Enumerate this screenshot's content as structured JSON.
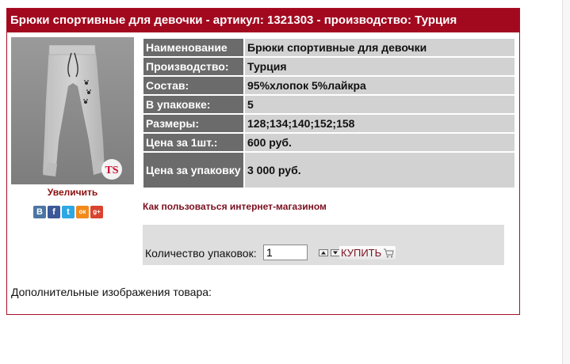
{
  "header": {
    "title": "Брюки спортивные для девочки - артикул: 1321303 - производство: Турция"
  },
  "photo": {
    "brand_mark": "TS"
  },
  "zoom": {
    "label": "Увеличить"
  },
  "share": {
    "items": [
      {
        "icon": "vk-icon",
        "glyph": "В",
        "color": "#4c75a3"
      },
      {
        "icon": "facebook-icon",
        "glyph": "f",
        "color": "#3b5998"
      },
      {
        "icon": "twitter-icon",
        "glyph": "t",
        "color": "#2ea8e5"
      },
      {
        "icon": "odnoklassniki-icon",
        "glyph": "ок",
        "color": "#f28a1b"
      },
      {
        "icon": "google-plus-icon",
        "glyph": "g+",
        "color": "#d9432f"
      }
    ]
  },
  "properties": [
    {
      "key": "Наименование",
      "value": "Брюки спортивные для девочки"
    },
    {
      "key": "Производство:",
      "value": "Турция"
    },
    {
      "key": "Состав:",
      "value": "95%хлопок 5%лайкра"
    },
    {
      "key": "В упаковке:",
      "value": "5"
    },
    {
      "key": "Размеры:",
      "value": "128;134;140;152;158"
    },
    {
      "key": "Цена за 1шт.:",
      "value": "600 руб."
    },
    {
      "key": "Цена за упаковку",
      "value": "3 000 руб."
    }
  ],
  "howto": {
    "label": "Как пользоваться интернет-магазином"
  },
  "order": {
    "qty_label": "Количество упаковок:",
    "qty_value": "1",
    "buy_label": "КУПИТЬ"
  },
  "extra": {
    "label": "Дополнительные изображения товара:"
  },
  "colors": {
    "accent": "#a2091f",
    "key_cell": "#6b6b6b",
    "value_cell": "#d2d2d2"
  }
}
